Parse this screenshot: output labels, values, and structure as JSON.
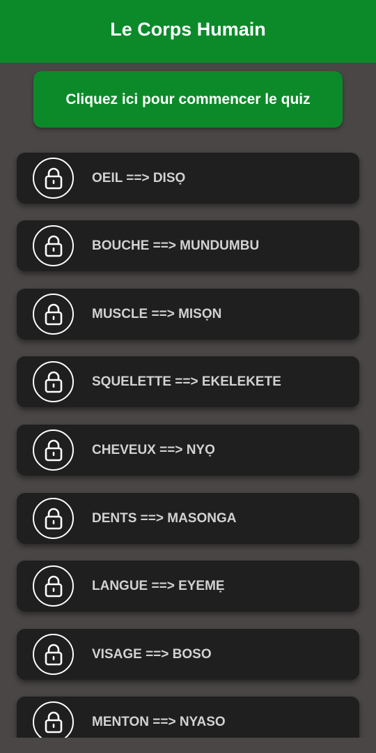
{
  "app_bar": {
    "title": "Le Corps Humain",
    "color": "#0c8a2a"
  },
  "quiz_button": {
    "label": "Cliquez ici pour commencer le quiz"
  },
  "lock_icon": "lock-icon",
  "items": [
    {
      "label": "OEIL ==> DISỌ"
    },
    {
      "label": "BOUCHE ==> MUNDUMBU"
    },
    {
      "label": "MUSCLE ==> MISỌN"
    },
    {
      "label": "SQUELETTE ==> EKELEKETE"
    },
    {
      "label": "CHEVEUX ==> NYỌ"
    },
    {
      "label": "DENTS ==> MASONGA"
    },
    {
      "label": "LANGUE ==> EYEMẸ"
    },
    {
      "label": "VISAGE ==> BOSO"
    },
    {
      "label": "MENTON ==> NYASO"
    }
  ]
}
